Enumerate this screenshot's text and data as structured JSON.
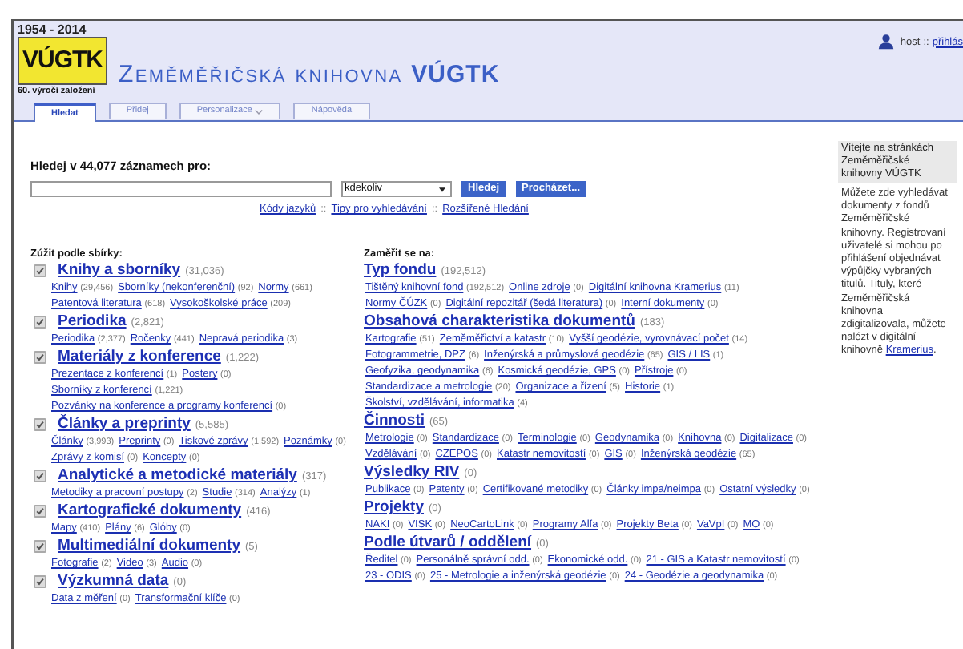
{
  "header": {
    "logo": {
      "years": "1954 - 2014",
      "mark": "VÚGTK",
      "caption": "60. výročí založení"
    },
    "title": "Zeměměřičská knihovna **VÚGTK**",
    "user": {
      "name": "host",
      "separator": "::",
      "link": "přihlás"
    }
  },
  "tabs": [
    {
      "label": "Hledat",
      "selected": true,
      "dropdown": false
    },
    {
      "label": "Přidej",
      "selected": false,
      "dropdown": false
    },
    {
      "label": "Personalizace",
      "selected": false,
      "dropdown": true
    },
    {
      "label": "Nápověda",
      "selected": false,
      "dropdown": false
    }
  ],
  "search": {
    "label": "Hledej v 44,077 záznamech pro:",
    "scope": "kdekoliv",
    "buttons": [
      "Hledej",
      "Procházet..."
    ],
    "separator": "::",
    "links": [
      "Kódy jazyků",
      "Tipy pro vyhledávání",
      "Rozšířené Hledání"
    ]
  },
  "collections": {
    "heading": "Zúžit podle sbírky:",
    "groups": [
      {
        "title": "Knihy a sborníky",
        "count": "(31,036)",
        "checked": true,
        "items": [
          {
            "label": "Knihy",
            "count": "(29,456)"
          },
          {
            "label": "Sborníky (nekonferenční)",
            "count": "(92)"
          },
          {
            "label": "Normy",
            "count": "(661)"
          },
          {
            "label": "Patentová literatura",
            "count": "(618)"
          },
          {
            "label": "Vysokoškolské práce",
            "count": "(209)"
          }
        ]
      },
      {
        "title": "Periodika",
        "count": "(2,821)",
        "checked": true,
        "items": [
          {
            "label": "Periodika",
            "count": "(2,377)"
          },
          {
            "label": "Ročenky",
            "count": "(441)"
          },
          {
            "label": "Nepravá periodika",
            "count": "(3)"
          }
        ]
      },
      {
        "title": "Materiály z konference",
        "count": "(1,222)",
        "checked": true,
        "items": [
          {
            "label": "Prezentace z konferencí",
            "count": "(1)"
          },
          {
            "label": "Postery",
            "count": "(0)"
          },
          {
            "label": "Sborníky z konferencí",
            "count": "(1,221)"
          },
          {
            "label": "Pozvánky na konference a programy konferencí",
            "count": "(0)"
          }
        ]
      },
      {
        "title": "Články a preprinty",
        "count": "(5,585)",
        "checked": true,
        "items": [
          {
            "label": "Články",
            "count": "(3,993)"
          },
          {
            "label": "Preprinty",
            "count": "(0)"
          },
          {
            "label": "Tiskové zprávy",
            "count": "(1,592)"
          },
          {
            "label": "Poznámky",
            "count": "(0)"
          },
          {
            "label": "Zprávy z komisí",
            "count": "(0)"
          },
          {
            "label": "Koncepty",
            "count": "(0)"
          }
        ]
      },
      {
        "title": "Analytické a metodické materiály",
        "count": "(317)",
        "checked": true,
        "items": [
          {
            "label": "Metodiky a pracovní postupy",
            "count": "(2)"
          },
          {
            "label": "Studie",
            "count": "(314)"
          },
          {
            "label": "Analýzy",
            "count": "(1)"
          }
        ]
      },
      {
        "title": "Kartografické dokumenty",
        "count": "(416)",
        "checked": true,
        "items": [
          {
            "label": "Mapy",
            "count": "(410)"
          },
          {
            "label": "Plány",
            "count": "(6)"
          },
          {
            "label": "Glóby",
            "count": "(0)"
          }
        ]
      },
      {
        "title": "Multimediální dokumenty",
        "count": "(5)",
        "checked": true,
        "items": [
          {
            "label": "Fotografie",
            "count": "(2)"
          },
          {
            "label": "Video",
            "count": "(3)"
          },
          {
            "label": "Audio",
            "count": "(0)"
          }
        ]
      },
      {
        "title": "Výzkumná data",
        "count": "(0)",
        "checked": true,
        "items": [
          {
            "label": "Data z měření",
            "count": "(0)"
          },
          {
            "label": "Transformační klíče",
            "count": "(0)"
          }
        ]
      }
    ]
  },
  "focus": {
    "heading": "Zaměřit se na:",
    "groups": [
      {
        "title": "Typ fondu",
        "count": "(192,512)",
        "items": [
          {
            "label": "Tištěný knihovní fond",
            "count": "(192,512)"
          },
          {
            "label": "Online zdroje",
            "count": "(0)"
          },
          {
            "label": "Digitální knihovna Kramerius",
            "count": "(11)"
          },
          {
            "label": "Normy ČÚZK",
            "count": "(0)"
          },
          {
            "label": "Digitální repozitář (šedá literatura)",
            "count": "(0)"
          },
          {
            "label": "Interní dokumenty",
            "count": "(0)"
          }
        ]
      },
      {
        "title": "Obsahová charakteristika dokumentů",
        "count": "(183)",
        "items": [
          {
            "label": "Kartografie",
            "count": "(51)"
          },
          {
            "label": "Zeměměřictví a katastr",
            "count": "(10)"
          },
          {
            "label": "Vyšší geodézie, vyrovnávací počet",
            "count": "(14)"
          },
          {
            "label": "Fotogrammetrie, DPZ",
            "count": "(6)"
          },
          {
            "label": "Inženýrská a průmyslová geodézie",
            "count": "(65)"
          },
          {
            "label": "GIS / LIS",
            "count": "(1)"
          },
          {
            "label": "Geofyzika, geodynamika",
            "count": "(6)"
          },
          {
            "label": "Kosmická geodézie, GPS",
            "count": "(0)"
          },
          {
            "label": "Přístroje",
            "count": "(0)"
          },
          {
            "label": "Standardizace a metrologie",
            "count": "(20)"
          },
          {
            "label": "Organizace a řízení",
            "count": "(5)"
          },
          {
            "label": "Historie",
            "count": "(1)"
          },
          {
            "label": "Školství, vzdělávání, informatika",
            "count": "(4)"
          }
        ]
      },
      {
        "title": "Činnosti",
        "count": "(65)",
        "items": [
          {
            "label": "Metrologie",
            "count": "(0)"
          },
          {
            "label": "Standardizace",
            "count": "(0)"
          },
          {
            "label": "Terminologie",
            "count": "(0)"
          },
          {
            "label": "Geodynamika",
            "count": "(0)"
          },
          {
            "label": "Knihovna",
            "count": "(0)"
          },
          {
            "label": "Digitalizace",
            "count": "(0)"
          },
          {
            "label": "Vzdělávání",
            "count": "(0)"
          },
          {
            "label": "CZEPOS",
            "count": "(0)"
          },
          {
            "label": "Katastr nemovitostí",
            "count": "(0)"
          },
          {
            "label": "GIS",
            "count": "(0)"
          },
          {
            "label": "Inženýrská geodézie",
            "count": "(65)"
          }
        ]
      },
      {
        "title": "Výsledky RIV",
        "count": "(0)",
        "items": [
          {
            "label": "Publikace",
            "count": "(0)"
          },
          {
            "label": "Patenty",
            "count": "(0)"
          },
          {
            "label": "Certifikované metodiky",
            "count": "(0)"
          },
          {
            "label": "Články impa/neimpa",
            "count": "(0)"
          },
          {
            "label": "Ostatní výsledky",
            "count": "(0)"
          }
        ]
      },
      {
        "title": "Projekty",
        "count": "(0)",
        "items": [
          {
            "label": "NAKI",
            "count": "(0)"
          },
          {
            "label": "VISK",
            "count": "(0)"
          },
          {
            "label": "NeoCartoLink",
            "count": "(0)"
          },
          {
            "label": "Programy Alfa",
            "count": "(0)"
          },
          {
            "label": "Projekty Beta",
            "count": "(0)"
          },
          {
            "label": "VaVpI",
            "count": "(0)"
          },
          {
            "label": "MO",
            "count": "(0)"
          }
        ]
      },
      {
        "title": "Podle útvarů / oddělení",
        "count": "(0)",
        "items": [
          {
            "label": "Ředitel",
            "count": "(0)"
          },
          {
            "label": "Personálně správní odd.",
            "count": "(0)"
          },
          {
            "label": "Ekonomické odd.",
            "count": "(0)"
          },
          {
            "label": "21 - GIS a Katastr nemovitostí",
            "count": "(0)"
          },
          {
            "label": "23 - ODIS",
            "count": "(0)"
          },
          {
            "label": "25 - Metrologie a inženýrská geodézie",
            "count": "(0)"
          },
          {
            "label": "24 - Geodézie a geodynamika",
            "count": "(0)"
          }
        ]
      }
    ]
  },
  "sidebar": {
    "title": "Vítejte na stránkách Zeměměřičské knihovny VÚGTK",
    "text": "Můžete zde vyhledávat dokumenty z fondů Zeměměřičské knihovny. Registrovaní uživatelé si mohou po přihlášení objednávat výpůjčky vybraných titulů. Tituly, které Zeměměřičská knihovna zdigitalizovala, můžete nalézt v digitální knihovně",
    "link": "Kramerius",
    "end": "."
  }
}
